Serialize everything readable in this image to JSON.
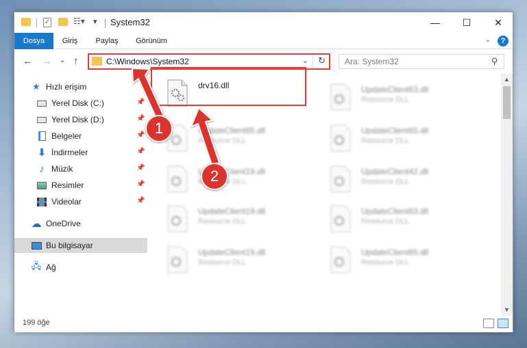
{
  "window": {
    "title": "System32",
    "controls": {
      "minimize": "—",
      "maximize": "☐",
      "close": "✕"
    }
  },
  "ribbon": {
    "tabs": [
      {
        "label": "Dosya",
        "active": true
      },
      {
        "label": "Giriş"
      },
      {
        "label": "Paylaş"
      },
      {
        "label": "Görünüm"
      }
    ],
    "help": "?"
  },
  "nav": {
    "address": "C:\\Windows\\System32",
    "search_placeholder": "Ara: System32"
  },
  "sidebar": {
    "items": [
      {
        "label": "Hızlı erişim",
        "icon": "star-icon"
      },
      {
        "label": "Yerel Disk (C:)",
        "icon": "drive-icon",
        "pinned": true
      },
      {
        "label": "Yerel Disk (D:)",
        "icon": "drive-icon",
        "pinned": true
      },
      {
        "label": "Belgeler",
        "icon": "documents-icon",
        "pinned": true
      },
      {
        "label": "İndirmeler",
        "icon": "downloads-icon",
        "pinned": true
      },
      {
        "label": "Müzik",
        "icon": "music-icon",
        "pinned": true
      },
      {
        "label": "Resimler",
        "icon": "pictures-icon",
        "pinned": true
      },
      {
        "label": "Videolar",
        "icon": "videos-icon",
        "pinned": true
      },
      {
        "label": "OneDrive",
        "icon": "cloud-icon"
      },
      {
        "label": "Bu bilgisayar",
        "icon": "computer-icon",
        "selected": true
      },
      {
        "label": "Ağ",
        "icon": "network-icon"
      }
    ]
  },
  "files": [
    {
      "name": "drv16.dll",
      "type": ""
    },
    {
      "name": "UpdateClient63.dll",
      "type": "Resource DLL"
    },
    {
      "name": "UpdateClient65.dll",
      "type": "Resource DLL"
    },
    {
      "name": "UpdateClient65.dll",
      "type": "Resource DLL"
    },
    {
      "name": "UpdateClient19.dll",
      "type": "Resource DLL"
    },
    {
      "name": "UpdateClient42.dll",
      "type": "Resource DLL"
    },
    {
      "name": "UpdateClient19.dll",
      "type": "Resource DLL"
    },
    {
      "name": "UpdateClient63.dll",
      "type": "Resource DLL"
    },
    {
      "name": "UpdateClient19.dll",
      "type": "Resource DLL"
    },
    {
      "name": "UpdateClient65.dll",
      "type": "Resource DLL"
    }
  ],
  "status": {
    "count": "199 öğe"
  },
  "annotations": {
    "badge_1": "1",
    "badge_2": "2",
    "color": "#d9352e"
  }
}
